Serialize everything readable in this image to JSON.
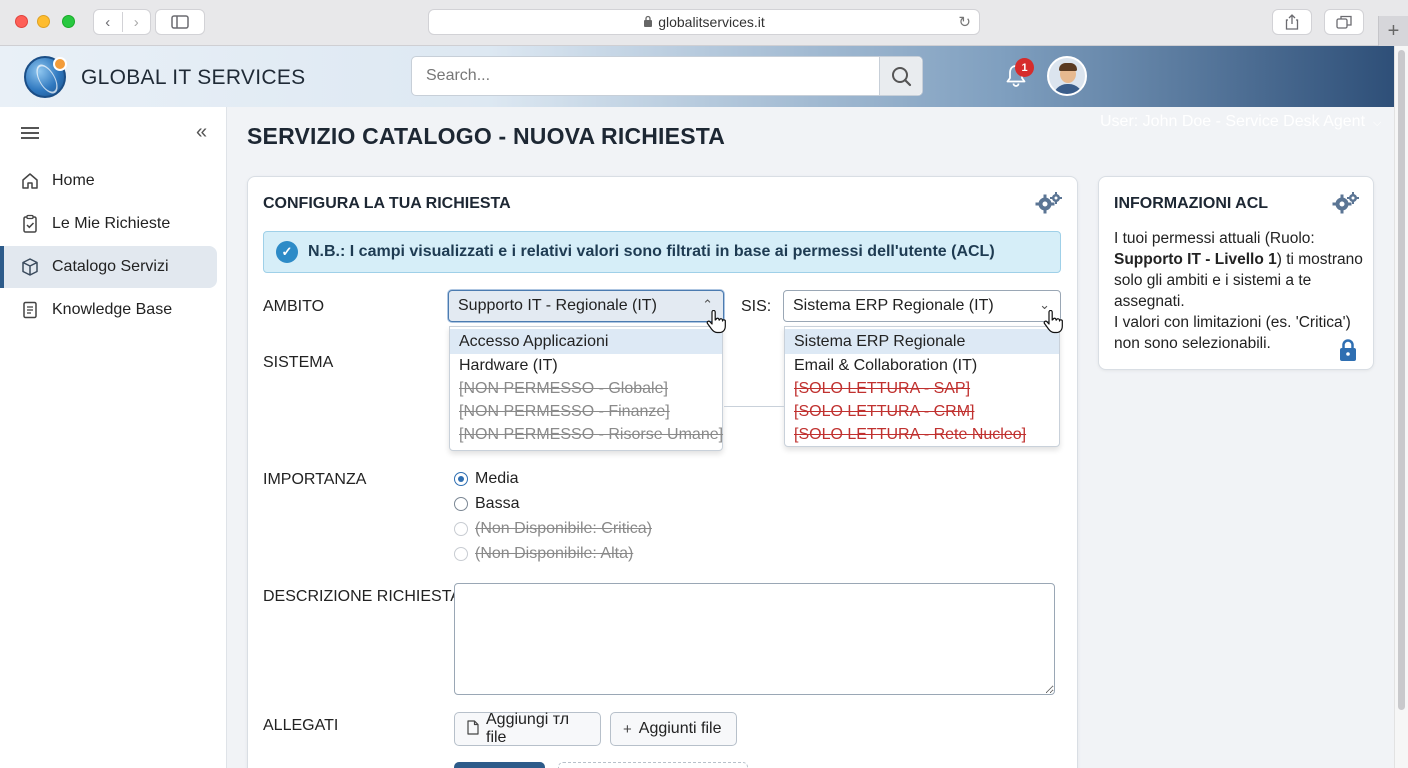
{
  "browser": {
    "url": "globalitservices.it",
    "back_icon": "chevron-left-icon",
    "forward_icon": "chevron-right-icon"
  },
  "header": {
    "brand": "GLOBAL IT SERVICES",
    "search_placeholder": "Search...",
    "notification_count": "1",
    "user_label": "User: John Doe - Service Desk Agent"
  },
  "sidebar": {
    "items": [
      {
        "label": "Home",
        "icon": "home-icon"
      },
      {
        "label": "Le Mie Richieste",
        "icon": "clipboard-check-icon"
      },
      {
        "label": "Catalogo Servizi",
        "icon": "box-icon",
        "active": true
      },
      {
        "label": "Knowledge Base",
        "icon": "book-icon"
      }
    ]
  },
  "main": {
    "title": "SERVIZIO CATALOGO - NUOVA RICHIESTA",
    "form": {
      "title": "CONFIGURA LA TUA RICHIESTA",
      "notice": "N.B.: I campi visualizzati e i relativi valori sono filtrati in base ai permessi dell'utente (ACL)",
      "ambito": {
        "label": "AMBITO",
        "value": "Supporto IT - Regionale (IT)",
        "options": [
          {
            "label": "Accesso Applicazioni",
            "state": "highlighted"
          },
          {
            "label": "Hardware (IT)",
            "state": "normal"
          },
          {
            "label": "[NON PERMESSO - Globale]",
            "state": "disabled"
          },
          {
            "label": "[NON PERMESSO - Finanze]",
            "state": "disabled"
          },
          {
            "label": "[NON PERMESSO - Risorse Umane]",
            "state": "disabled"
          }
        ]
      },
      "sis": {
        "label": "SIS:",
        "value": "Sistema ERP Regionale (IT)",
        "options": [
          {
            "label": "Sistema ERP Regionale",
            "state": "highlighted"
          },
          {
            "label": "Email & Collaboration (IT)",
            "state": "normal"
          },
          {
            "label": "[SOLO LETTURA - SAP]",
            "state": "readonly"
          },
          {
            "label": "[SOLO LETTURA - CRM]",
            "state": "readonly"
          },
          {
            "label": "[SOLO LETTURA - Rete Nucleo]",
            "state": "readonly"
          }
        ]
      },
      "sistema_label": "SISTEMA",
      "importanza": {
        "label": "IMPORTANZA",
        "options": [
          {
            "label": "Media",
            "selected": true,
            "disabled": false
          },
          {
            "label": "Bassa",
            "selected": false,
            "disabled": false
          },
          {
            "label": "(Non Disponibile: Critica)",
            "selected": false,
            "disabled": true
          },
          {
            "label": "(Non Disponibile: Alta)",
            "selected": false,
            "disabled": true
          }
        ]
      },
      "descrizione_label": "DESCRIZIONE RICHIESTA",
      "descrizione_value": "",
      "allegati": {
        "label": "ALLEGATI",
        "button1": "Aggiungi тл file",
        "button2": "Aggiunti file"
      }
    },
    "acl": {
      "title": "INFORMAZIONI ACL",
      "line1_pre": "I tuoi permessi attuali (Ruolo: ",
      "role": "Supporto IT - Livello 1",
      "line1_post": ") ti mostrano solo gli ambiti e i sistemi a te assegnati.",
      "line2": "I valori con limitazioni (es. 'Critica') non sono selezionabili."
    }
  },
  "colors": {
    "accent": "#2d5b8a",
    "notice_bg": "#d6eef8",
    "readonly": "#c0312f",
    "badge": "#d62c2c"
  }
}
